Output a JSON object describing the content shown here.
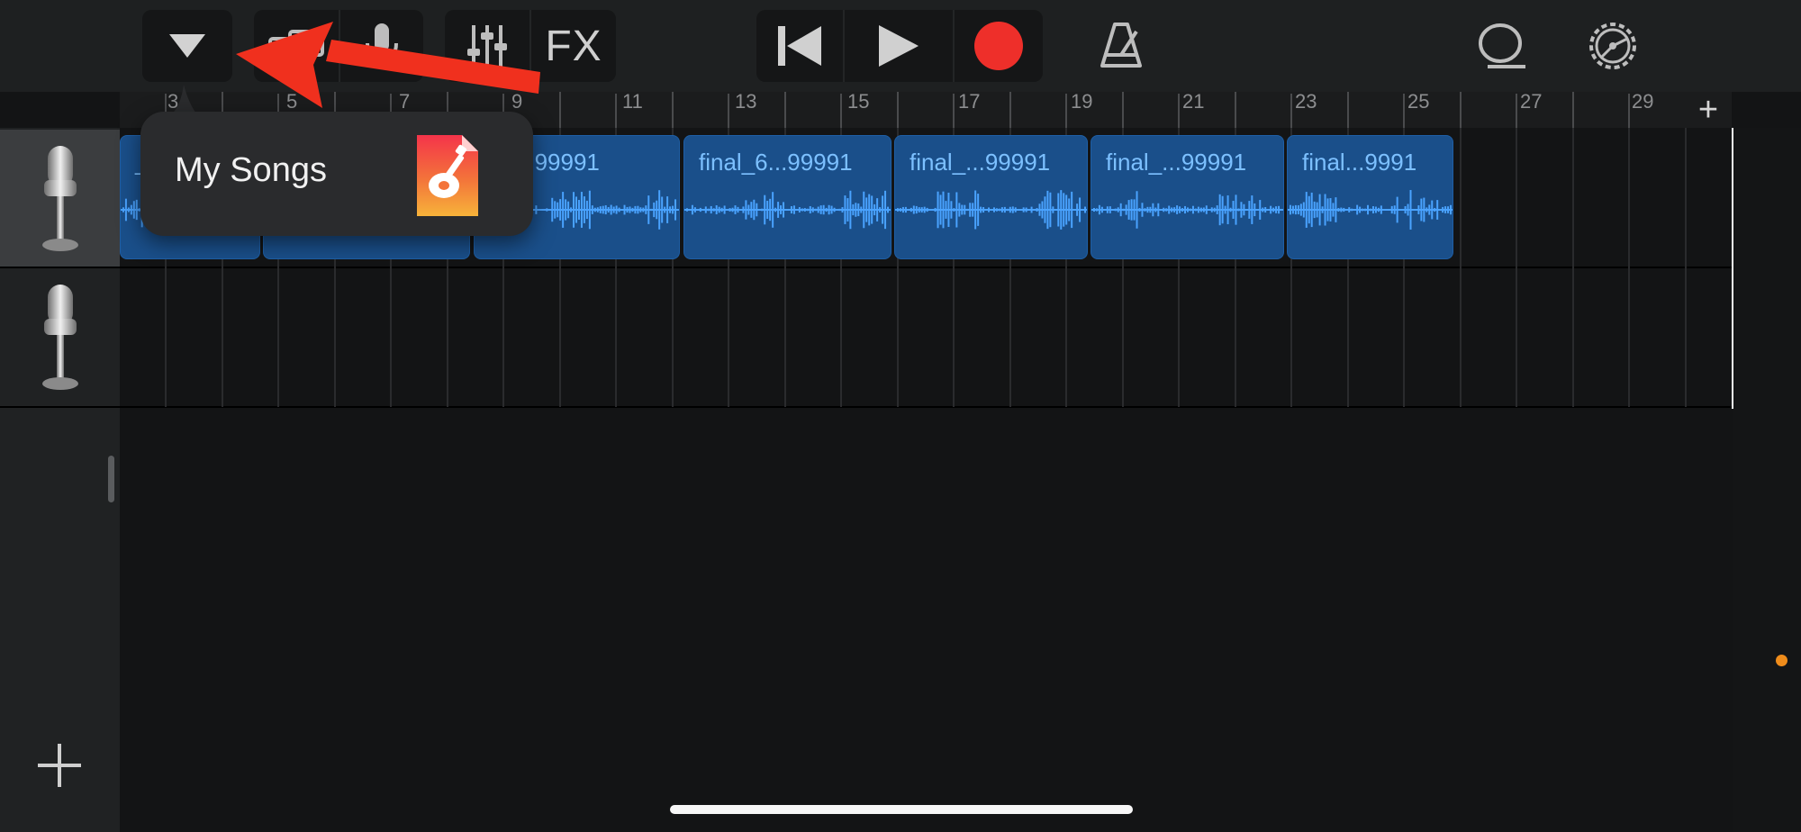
{
  "toolbar": {
    "browser_toggle_icon": "triangle-down-icon",
    "view_icon": "tracks-view-icon",
    "mic_icon": "microphone-icon",
    "mixer_icon": "sliders-icon",
    "fx_label": "FX",
    "rewind_icon": "skip-back-icon",
    "play_icon": "play-icon",
    "record_icon": "record-icon",
    "record_color": "#ee2f2a",
    "metronome_icon": "metronome-icon",
    "loop_icon": "loop-icon",
    "settings_icon": "gear-icon"
  },
  "ruler": {
    "labels": [
      "3",
      "5",
      "7",
      "9",
      "11",
      "13",
      "15",
      "17",
      "19",
      "21",
      "23",
      "25",
      "27",
      "29"
    ],
    "add_label": "+"
  },
  "tracks": [
    {
      "icon": "microphone-icon",
      "selected": true
    },
    {
      "icon": "microphone-icon",
      "selected": false
    }
  ],
  "regions": [
    {
      "name": "_6"
    },
    {
      "name": ""
    },
    {
      "name": "_6...99991"
    },
    {
      "name": "final_6...99991"
    },
    {
      "name": "final_...99991"
    },
    {
      "name": "final_...99991"
    },
    {
      "name": "final...9991"
    }
  ],
  "region_color": "#1a4f8a",
  "waveform_color": "#4aa3ff",
  "popover": {
    "label": "My Songs",
    "icon": "garageband-file-icon"
  },
  "annotation": {
    "type": "arrow",
    "color": "#f0301e"
  },
  "sidebar": {
    "add_track_label": "+"
  }
}
